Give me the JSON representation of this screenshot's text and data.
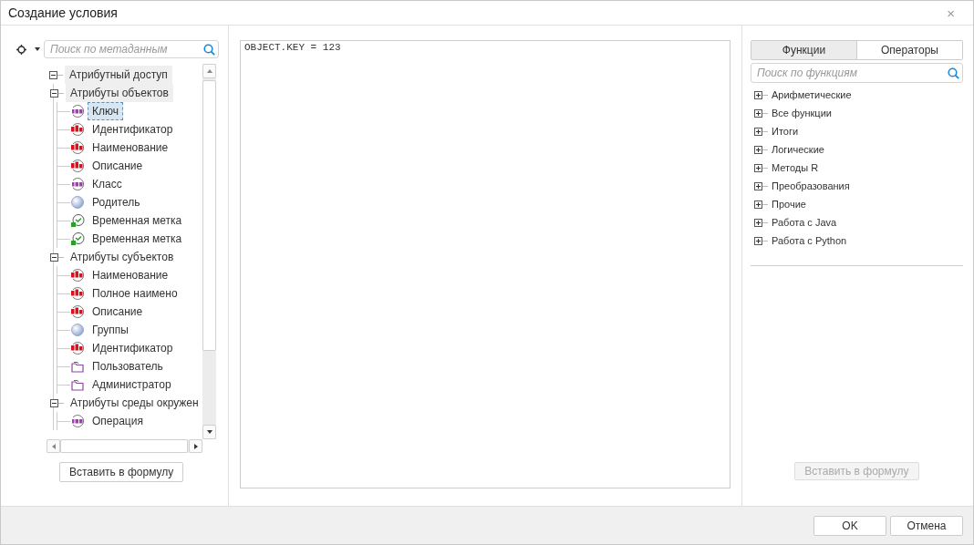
{
  "window": {
    "title": "Создание условия",
    "close": "×"
  },
  "metadata_search": {
    "placeholder": "Поиск по метаданным"
  },
  "tree": [
    {
      "label": "Атрибутный доступ",
      "expanded": true,
      "highlighted": true,
      "children": [
        {
          "label": "Атрибуты объектов",
          "expanded": true,
          "highlighted": true,
          "children": [
            {
              "label": "Ключ",
              "kind": "number",
              "selected": true
            },
            {
              "label": "Идентификатор",
              "kind": "text",
              "selected": false
            },
            {
              "label": "Наименование",
              "kind": "text",
              "selected": false
            },
            {
              "label": "Описание",
              "kind": "text",
              "selected": false
            },
            {
              "label": "Класс",
              "kind": "number",
              "selected": false
            },
            {
              "label": "Родитель",
              "kind": "object",
              "selected": false
            },
            {
              "label": "Временная метка",
              "kind": "timestamp",
              "selected": false
            },
            {
              "label": "Временная метка",
              "kind": "timestamp",
              "selected": false
            }
          ]
        },
        {
          "label": "Атрибуты субъектов",
          "expanded": true,
          "highlighted": false,
          "children": [
            {
              "label": "Наименование",
              "kind": "text",
              "selected": false
            },
            {
              "label": "Полное наимено",
              "kind": "text",
              "selected": false
            },
            {
              "label": "Описание",
              "kind": "text",
              "selected": false
            },
            {
              "label": "Группы",
              "kind": "object",
              "selected": false
            },
            {
              "label": "Идентификатор",
              "kind": "text",
              "selected": false
            },
            {
              "label": "Пользователь",
              "kind": "folder",
              "selected": false
            },
            {
              "label": "Администратор",
              "kind": "folder",
              "selected": false
            }
          ]
        },
        {
          "label": "Атрибуты среды окружен",
          "expanded": true,
          "highlighted": false,
          "children": [
            {
              "label": "Операция",
              "kind": "number",
              "selected": false
            }
          ]
        }
      ]
    }
  ],
  "left_insert_button": {
    "label": "Вставить в формулу",
    "disabled": false
  },
  "formula": {
    "value": "OBJECT.KEY = 123"
  },
  "tabs": [
    {
      "label": "Функции",
      "selected": true
    },
    {
      "label": "Операторы",
      "selected": false
    }
  ],
  "function_search": {
    "placeholder": "Поиск по функциям"
  },
  "function_groups": [
    {
      "label": "Арифметические",
      "expanded": false
    },
    {
      "label": "Все функции",
      "expanded": false
    },
    {
      "label": "Итоги",
      "expanded": false
    },
    {
      "label": "Логические",
      "expanded": false
    },
    {
      "label": "Методы R",
      "expanded": false
    },
    {
      "label": "Преобразования",
      "expanded": false
    },
    {
      "label": "Прочие",
      "expanded": false
    },
    {
      "label": "Работа с Java",
      "expanded": false
    },
    {
      "label": "Работа с Python",
      "expanded": false
    }
  ],
  "right_insert_button": {
    "label": "Вставить в формулу",
    "disabled": true
  },
  "footer_buttons": [
    "OK",
    "Отмена"
  ]
}
